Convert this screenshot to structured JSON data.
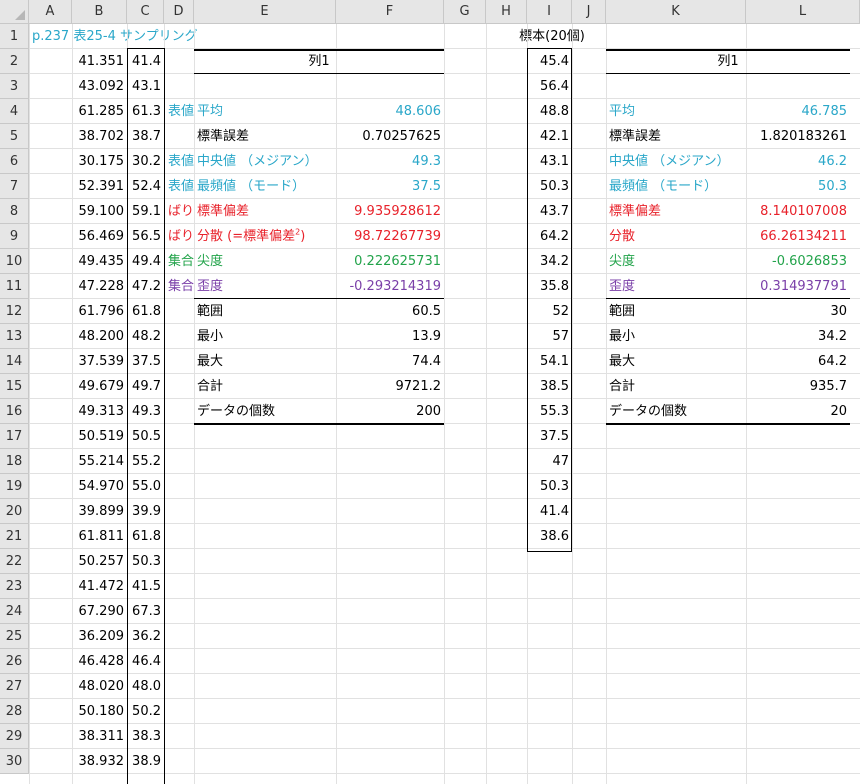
{
  "columns": [
    "A",
    "B",
    "C",
    "D",
    "E",
    "F",
    "G",
    "H",
    "I",
    "J",
    "K",
    "L"
  ],
  "rows": [
    "1",
    "2",
    "3",
    "4",
    "5",
    "6",
    "7",
    "8",
    "9",
    "10",
    "11",
    "12",
    "13",
    "14",
    "15",
    "16",
    "17",
    "18",
    "19",
    "20",
    "21",
    "22",
    "23",
    "24",
    "25",
    "26",
    "27",
    "28",
    "29",
    "30"
  ],
  "title": "p.237 表25-4 サンプリング",
  "sample_header": "標本(20個)",
  "col_b": [
    "41.351",
    "43.092",
    "61.285",
    "38.702",
    "30.175",
    "52.391",
    "59.100",
    "56.469",
    "49.435",
    "47.228",
    "61.796",
    "48.200",
    "37.539",
    "49.679",
    "49.313",
    "50.519",
    "55.214",
    "54.970",
    "39.899",
    "61.811",
    "50.257",
    "41.472",
    "67.290",
    "36.209",
    "46.428",
    "48.020",
    "50.180",
    "38.311",
    "38.932"
  ],
  "col_c": [
    "41.4",
    "43.1",
    "61.3",
    "38.7",
    "30.2",
    "52.4",
    "59.1",
    "56.5",
    "49.4",
    "47.2",
    "61.8",
    "48.2",
    "37.5",
    "49.7",
    "49.3",
    "50.5",
    "55.2",
    "55.0",
    "39.9",
    "61.8",
    "50.3",
    "41.5",
    "67.3",
    "36.2",
    "46.4",
    "48.0",
    "50.2",
    "38.3",
    "38.9"
  ],
  "col_d_fragments": [
    "表値",
    "表値",
    "表値",
    "ばり",
    "ばり",
    "集合",
    "集合"
  ],
  "stats_left": {
    "header": "列1",
    "items": [
      {
        "label": "平均",
        "value": "48.606",
        "color": "cyan"
      },
      {
        "label": "標準誤差",
        "value": "0.70257625",
        "color": "black"
      },
      {
        "label": "中央値 （メジアン）",
        "value": "49.3",
        "color": "cyan"
      },
      {
        "label": "最頻値 （モード）",
        "value": "37.5",
        "color": "cyan"
      },
      {
        "label": "標準偏差",
        "value": "9.935928612",
        "color": "red"
      },
      {
        "label": "分散 (=標準偏差",
        "label_sup": "2",
        "label_tail": ")",
        "value": "98.72267739",
        "color": "red"
      },
      {
        "label": "尖度",
        "value": "0.222625731",
        "color": "green"
      },
      {
        "label": "歪度",
        "value": "-0.293214319",
        "color": "purple"
      },
      {
        "label": "範囲",
        "value": "60.5",
        "color": "black"
      },
      {
        "label": "最小",
        "value": "13.9",
        "color": "black"
      },
      {
        "label": "最大",
        "value": "74.4",
        "color": "black"
      },
      {
        "label": "合計",
        "value": "9721.2",
        "color": "black"
      },
      {
        "label": "データの個数",
        "value": "200",
        "color": "black"
      }
    ]
  },
  "sample_values": [
    "45.4",
    "56.4",
    "48.8",
    "42.1",
    "43.1",
    "50.3",
    "43.7",
    "64.2",
    "34.2",
    "35.8",
    "52",
    "57",
    "54.1",
    "38.5",
    "55.3",
    "37.5",
    "47",
    "50.3",
    "41.4",
    "38.6"
  ],
  "stats_right": {
    "header": "列1",
    "items": [
      {
        "label": "平均",
        "value": "46.785",
        "color": "cyan"
      },
      {
        "label": "標準誤差",
        "value": "1.820183261",
        "color": "black"
      },
      {
        "label": "中央値 （メジアン）",
        "value": "46.2",
        "color": "cyan"
      },
      {
        "label": "最頻値 （モード）",
        "value": "50.3",
        "color": "cyan"
      },
      {
        "label": "標準偏差",
        "value": "8.140107008",
        "color": "red"
      },
      {
        "label": "分散",
        "value": "66.26134211",
        "color": "red"
      },
      {
        "label": "尖度",
        "value": "-0.6026853",
        "color": "green"
      },
      {
        "label": "歪度",
        "value": "0.314937791",
        "color": "purple"
      },
      {
        "label": "範囲",
        "value": "30",
        "color": "black"
      },
      {
        "label": "最小",
        "value": "34.2",
        "color": "black"
      },
      {
        "label": "最大",
        "value": "64.2",
        "color": "black"
      },
      {
        "label": "合計",
        "value": "935.7",
        "color": "black"
      },
      {
        "label": "データの個数",
        "value": "20",
        "color": "black"
      }
    ]
  },
  "colors": {
    "cyan": "#2aa7c9",
    "red": "#e8212a",
    "green": "#22a34a",
    "purple": "#7a3fa8",
    "header_bg": "#e6e6e6",
    "grid": "#e1e1e1"
  }
}
